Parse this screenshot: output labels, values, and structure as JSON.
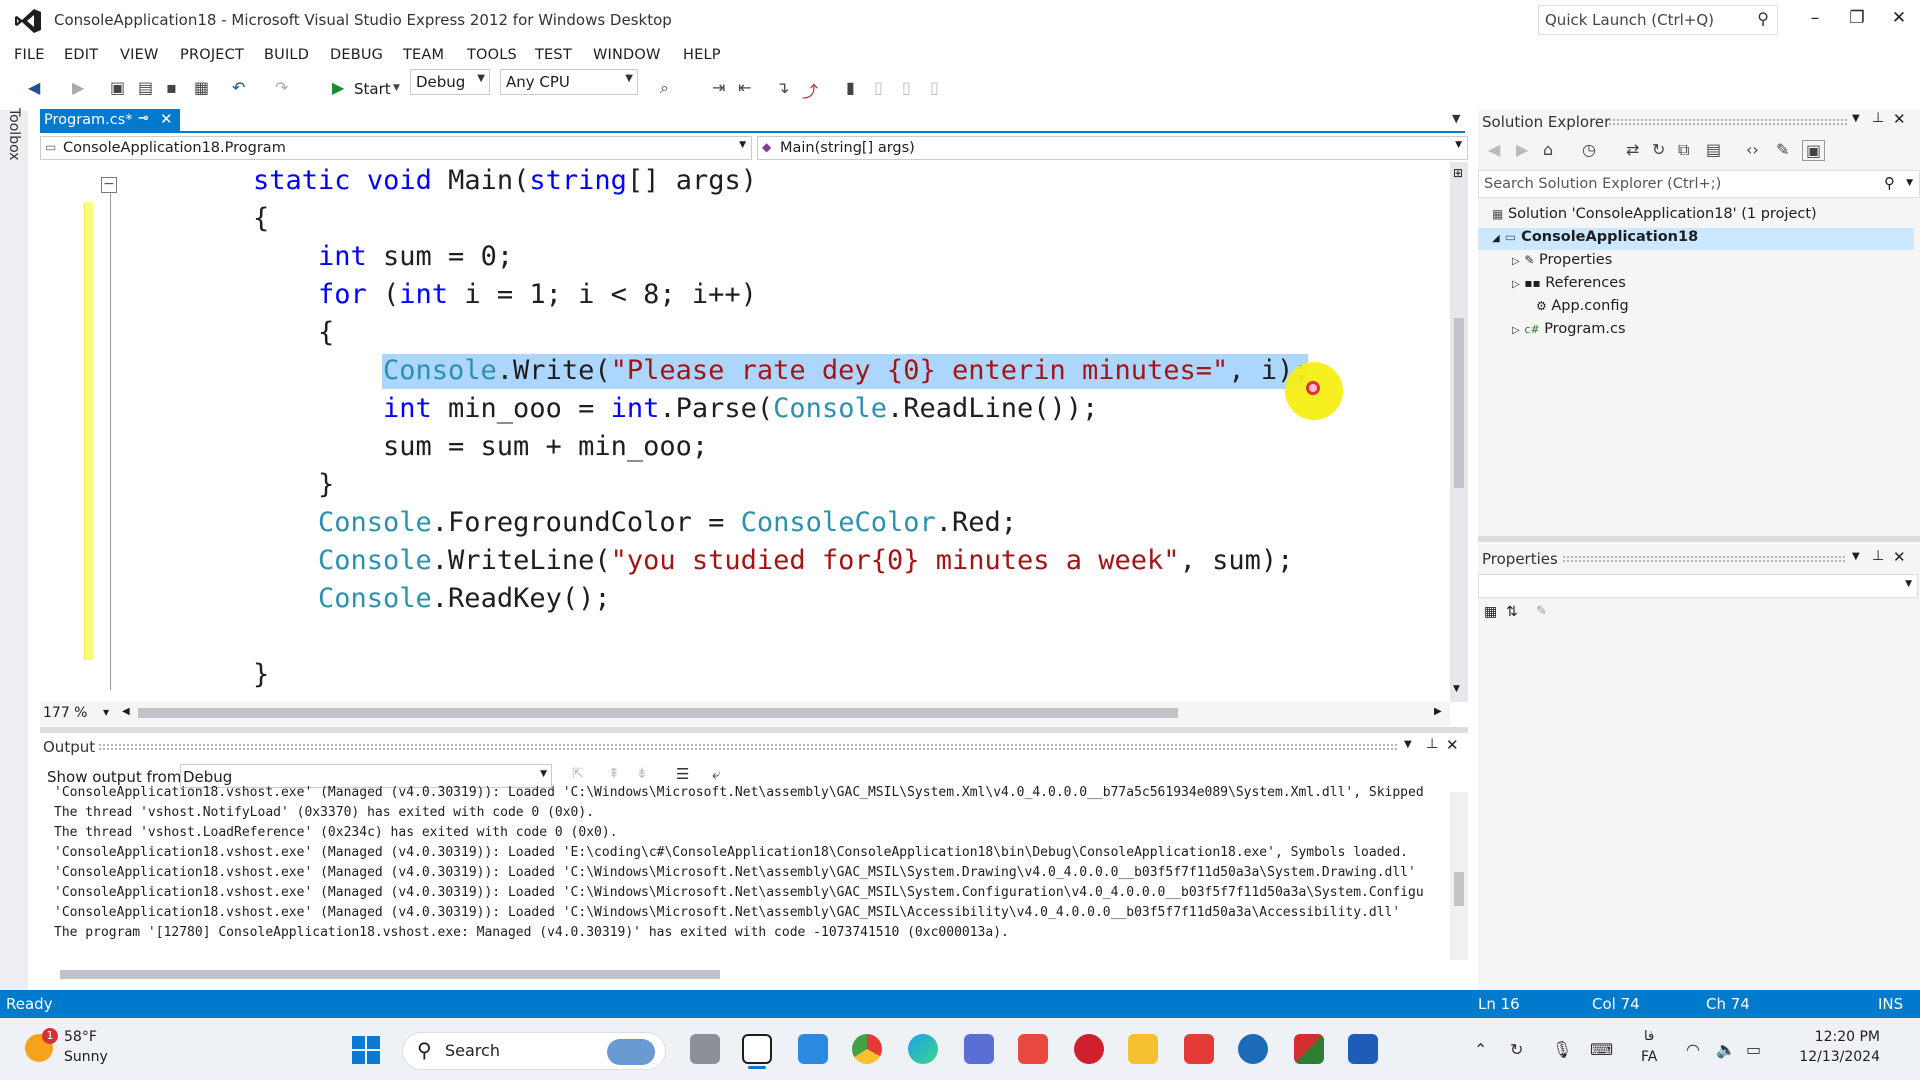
{
  "window": {
    "title": "ConsoleApplication18 - Microsoft Visual Studio Express 2012 for Windows Desktop",
    "quick_launch_placeholder": "Quick Launch (Ctrl+Q)"
  },
  "menu": [
    "FILE",
    "EDIT",
    "VIEW",
    "PROJECT",
    "BUILD",
    "DEBUG",
    "TEAM",
    "TOOLS",
    "TEST",
    "WINDOW",
    "HELP"
  ],
  "toolbar": {
    "start_label": "Start",
    "config": "Debug",
    "platform": "Any CPU"
  },
  "toolbox_label": "Toolbox",
  "document_tab": {
    "label": "Program.cs*"
  },
  "nav": {
    "type_scope": "ConsoleApplication18.Program",
    "member_scope": "Main(string[] args)"
  },
  "code": {
    "line1_kw1": "static",
    "line1_kw2": "void",
    "line1_rest": " Main(",
    "line1_kw3": "string",
    "line1_tail": "[] args)",
    "line2": "{",
    "line3_kw": "int",
    "line3_rest": " sum = 0;",
    "line4_kw": "for",
    "line4_a": " (",
    "line4_kw2": "int",
    "line4_rest": " i = 1; i < 8; i++)",
    "line5": "{",
    "line6_ty": "Console",
    "line6_a": ".Write(",
    "line6_str": "\"Please rate dey {0} enterin minutes=\"",
    "line6_tail": ", i);",
    "line7_kw": "int",
    "line7_a": " min_ooo = ",
    "line7_kw2": "int",
    "line7_b": ".Parse(",
    "line7_ty": "Console",
    "line7_tail": ".ReadLine());",
    "line8": "sum = sum + min_ooo;",
    "line9": "}",
    "line10_ty": "Console",
    "line10_a": ".ForegroundColor = ",
    "line10_ty2": "ConsoleColor",
    "line10_tail": ".Red;",
    "line11_ty": "Console",
    "line11_a": ".WriteLine(",
    "line11_str": "\"you studied for{0} minutes a week\"",
    "line11_tail": ", sum);",
    "line12_ty": "Console",
    "line12_tail": ".ReadKey();",
    "line14": "}"
  },
  "zoom": "177 %",
  "solution_explorer": {
    "title": "Solution Explorer",
    "search_placeholder": "Search Solution Explorer (Ctrl+;)",
    "solution": "Solution 'ConsoleApplication18' (1 project)",
    "project": "ConsoleApplication18",
    "items": [
      "Properties",
      "References",
      "App.config",
      "Program.cs"
    ]
  },
  "properties": {
    "title": "Properties"
  },
  "output": {
    "title": "Output",
    "show_from_label": "Show output from:",
    "source": "Debug",
    "lines": [
      "'ConsoleApplication18.vshost.exe' (Managed (v4.0.30319)): Loaded 'C:\\Windows\\Microsoft.Net\\assembly\\GAC_MSIL\\System.Xml\\v4.0_4.0.0.0__b77a5c561934e089\\System.Xml.dll', Skipped",
      "The thread 'vshost.NotifyLoad' (0x3370) has exited with code 0 (0x0).",
      "The thread 'vshost.LoadReference' (0x234c) has exited with code 0 (0x0).",
      "'ConsoleApplication18.vshost.exe' (Managed (v4.0.30319)): Loaded 'E:\\coding\\c#\\ConsoleApplication18\\ConsoleApplication18\\bin\\Debug\\ConsoleApplication18.exe', Symbols loaded.",
      "'ConsoleApplication18.vshost.exe' (Managed (v4.0.30319)): Loaded 'C:\\Windows\\Microsoft.Net\\assembly\\GAC_MSIL\\System.Drawing\\v4.0_4.0.0.0__b03f5f7f11d50a3a\\System.Drawing.dll'",
      "'ConsoleApplication18.vshost.exe' (Managed (v4.0.30319)): Loaded 'C:\\Windows\\Microsoft.Net\\assembly\\GAC_MSIL\\System.Configuration\\v4.0_4.0.0.0__b03f5f7f11d50a3a\\System.Configu",
      "'ConsoleApplication18.vshost.exe' (Managed (v4.0.30319)): Loaded 'C:\\Windows\\Microsoft.Net\\assembly\\GAC_MSIL\\Accessibility\\v4.0_4.0.0.0__b03f5f7f11d50a3a\\Accessibility.dll'",
      "The program '[12780] ConsoleApplication18.vshost.exe: Managed (v4.0.30319)' has exited with code -1073741510 (0xc000013a)."
    ]
  },
  "status": {
    "left": "Ready",
    "ln": "Ln 16",
    "col": "Col 74",
    "ch": "Ch 74",
    "mode": "INS"
  },
  "taskbar": {
    "weather_temp": "58°F",
    "weather_cond": "Sunny",
    "weather_badge": "1",
    "search_label": "Search",
    "lang_top": "فا",
    "lang_bottom": "FA",
    "time": "12:20 PM",
    "date": "12/13/2024"
  },
  "colors": {
    "accent": "#007acc",
    "keyword": "#0000ff",
    "type": "#2b91af",
    "string": "#a31515",
    "selection": "#add6ff"
  }
}
